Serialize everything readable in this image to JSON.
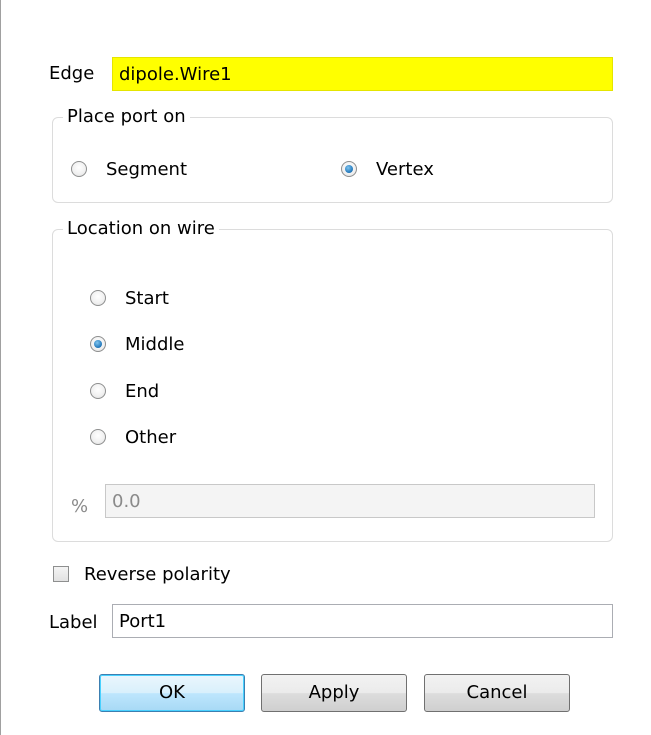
{
  "edge": {
    "label": "Edge",
    "value": "dipole.Wire1"
  },
  "place_port": {
    "title": "Place port on",
    "options": [
      {
        "label": "Segment",
        "checked": false
      },
      {
        "label": "Vertex",
        "checked": true
      }
    ]
  },
  "location": {
    "title": "Location on wire",
    "options": [
      {
        "label": "Start",
        "checked": false
      },
      {
        "label": "Middle",
        "checked": true
      },
      {
        "label": "End",
        "checked": false
      },
      {
        "label": "Other",
        "checked": false
      }
    ],
    "percent_label": "%",
    "percent_value": "0.0"
  },
  "reverse_polarity": {
    "label": "Reverse polarity",
    "checked": false
  },
  "label_field": {
    "label": "Label",
    "value": "Port1"
  },
  "buttons": {
    "ok": "OK",
    "apply": "Apply",
    "cancel": "Cancel"
  },
  "colors": {
    "edge_highlight": "#ffff00",
    "radio_selected": "#1f75b9",
    "default_button_border": "#3c7fb1"
  }
}
